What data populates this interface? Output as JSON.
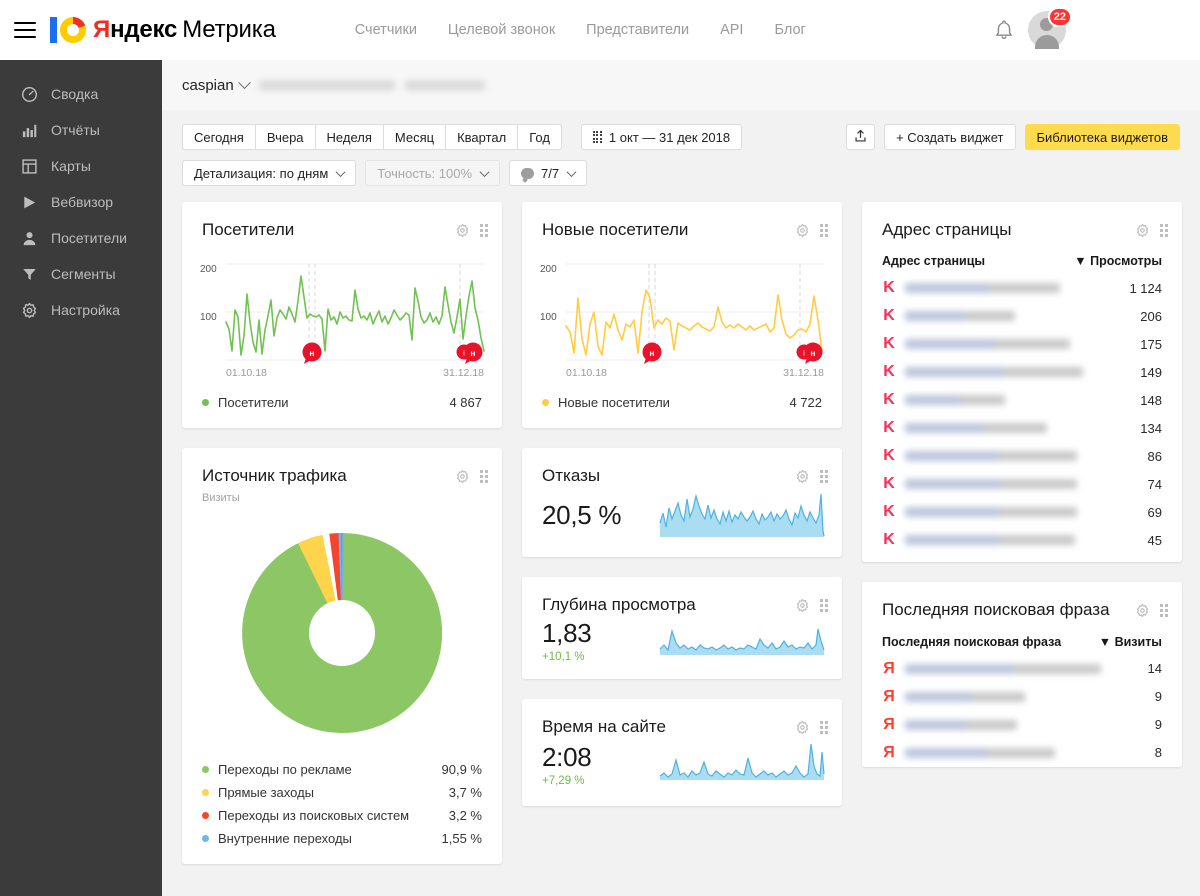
{
  "header": {
    "menu_icon": "hamburger-icon",
    "logo": {
      "ya": "Я",
      "ndeks": "ндекс",
      "product": "Метрика"
    },
    "nav": [
      {
        "label": "Счетчики"
      },
      {
        "label": "Целевой звонок"
      },
      {
        "label": "Представители"
      },
      {
        "label": "API"
      },
      {
        "label": "Блог"
      }
    ],
    "bell_icon": "bell-icon",
    "notification_count": "22",
    "avatar_icon": "user-avatar-icon",
    "user_name": ""
  },
  "sidebar": {
    "items": [
      {
        "label": "Сводка",
        "icon": "gauge-icon"
      },
      {
        "label": "Отчёты",
        "icon": "bar-chart-icon"
      },
      {
        "label": "Карты",
        "icon": "map-grid-icon"
      },
      {
        "label": "Вебвизор",
        "icon": "play-icon"
      },
      {
        "label": "Посетители",
        "icon": "person-icon"
      },
      {
        "label": "Сегменты",
        "icon": "funnel-icon"
      },
      {
        "label": "Настройка",
        "icon": "gear-icon"
      }
    ]
  },
  "breadcrumb": {
    "counter_name": "caspian",
    "chevron_icon": "chevron-down-icon",
    "site_redacted": "",
    "counter_id_redacted": ""
  },
  "toolbar": {
    "periods": [
      "Сегодня",
      "Вчера",
      "Неделя",
      "Месяц",
      "Квартал",
      "Год"
    ],
    "date_range": "1 окт — 31 дек 2018",
    "calendar_icon": "calendar-icon",
    "detail": "Детализация: по дням",
    "accuracy": "Точность: 100%",
    "comments": "7/7",
    "comment_icon": "speech-bubble-icon",
    "export_icon": "export-icon",
    "create_widget": "+ Создать виджет",
    "widget_library": "Библиотека виджетов",
    "accent_yellow": "#ffdb4d"
  },
  "widgets": {
    "visitors": {
      "title": "Посетители",
      "legend_label": "Посетители",
      "total": "4 867",
      "color": "#71c153",
      "x_start": "01.10.18",
      "x_end": "31.12.18",
      "y_ticks": [
        "200",
        "100"
      ],
      "marker_label": "н"
    },
    "new_visitors": {
      "title": "Новые посетители",
      "legend_label": "Новые посетители",
      "total": "4 722",
      "color": "#ffcc42",
      "x_start": "01.10.18",
      "x_end": "31.12.18",
      "y_ticks": [
        "200",
        "100"
      ],
      "marker_label": "н"
    },
    "traffic_source": {
      "title": "Источник трафика",
      "subtitle": "Визиты"
    },
    "bounce": {
      "title": "Отказы",
      "value": "20,5 %",
      "color": "#7ec8e8"
    },
    "depth": {
      "title": "Глубина просмотра",
      "value": "1,83",
      "delta": "+10,1 %",
      "color": "#7ec8e8"
    },
    "time_on_site": {
      "title": "Время на сайте",
      "value": "2:08",
      "delta": "+7,29 %",
      "color": "#7ec8e8"
    },
    "page_address": {
      "title": "Адрес страницы",
      "col_label": "Адрес страницы",
      "col_metric": "▼ Просмотры",
      "favicon": "K",
      "rows": [
        {
          "url": "",
          "views": "1 124"
        },
        {
          "url": "",
          "views": "206"
        },
        {
          "url": "",
          "views": "175"
        },
        {
          "url": "",
          "views": "149"
        },
        {
          "url": "",
          "views": "148"
        },
        {
          "url": "",
          "views": "134"
        },
        {
          "url": "",
          "views": "86"
        },
        {
          "url": "",
          "views": "74"
        },
        {
          "url": "",
          "views": "69"
        },
        {
          "url": "",
          "views": "45"
        }
      ]
    },
    "last_search_phrase": {
      "title": "Последняя поисковая фраза",
      "col_label": "Последняя поисковая фраза",
      "col_metric": "▼ Визиты",
      "favicon": "Я",
      "rows": [
        {
          "phrase": "",
          "visits": "14"
        },
        {
          "phrase": "",
          "visits": "9"
        },
        {
          "phrase": "",
          "visits": "9"
        },
        {
          "phrase": "",
          "visits": "8"
        }
      ]
    }
  },
  "chart_data": [
    {
      "type": "line",
      "title": "Посетители",
      "xlabel": "",
      "ylabel": "",
      "x": [
        "01.10.18",
        "31.12.18"
      ],
      "ylim": [
        0,
        230
      ],
      "yticks": [
        100,
        200
      ],
      "grid": true,
      "legend": [
        {
          "name": "Посетители",
          "total": 4867,
          "color": "#71c153"
        }
      ],
      "series": [
        {
          "name": "Посетители",
          "color": "#71c153",
          "values": [
            88,
            72,
            40,
            110,
            95,
            30,
            62,
            140,
            88,
            52,
            38,
            92,
            34,
            80,
            100,
            128,
            72,
            96,
            110,
            104,
            98,
            118,
            104,
            92,
            124,
            174,
            130,
            96,
            104,
            100,
            98,
            102,
            96,
            40,
            112,
            92,
            98,
            84,
            106,
            96,
            100,
            92,
            90,
            148,
            112,
            94,
            98,
            92,
            104,
            86,
            96,
            108,
            90,
            98,
            84,
            94,
            110,
            100,
            92,
            96,
            104,
            100,
            56,
            150,
            124,
            96,
            86,
            92,
            104,
            88,
            96,
            84,
            100,
            152,
            116,
            88,
            68,
            96,
            122,
            62,
            104,
            96,
            132,
            160,
            108,
            92,
            60,
            98,
            40
          ]
        }
      ]
    },
    {
      "type": "line",
      "title": "Новые посетители",
      "xlabel": "",
      "ylabel": "",
      "x": [
        "01.10.18",
        "31.12.18"
      ],
      "ylim": [
        0,
        230
      ],
      "yticks": [
        100,
        200
      ],
      "grid": true,
      "legend": [
        {
          "name": "Новые посетители",
          "total": 4722,
          "color": "#ffcc42"
        }
      ],
      "series": [
        {
          "name": "Новые посетители",
          "color": "#ffcc42",
          "values": [
            84,
            70,
            36,
            126,
            62,
            30,
            76,
            96,
            42,
            30,
            88,
            78,
            100,
            72,
            56,
            88,
            84,
            96,
            30,
            100,
            148,
            128,
            76,
            92,
            88,
            104,
            96,
            36,
            92,
            86,
            82,
            78,
            88,
            94,
            86,
            80,
            76,
            84,
            118,
            92,
            80,
            86,
            80,
            90,
            84,
            78,
            86,
            76,
            82,
            84,
            88,
            74,
            80,
            130,
            96,
            72,
            66,
            70,
            78,
            80,
            76,
            88,
            130,
            96,
            80,
            70,
            64,
            84,
            36,
            76,
            92,
            132,
            118,
            84,
            62,
            86,
            98,
            40
          ]
        }
      ]
    },
    {
      "type": "pie",
      "title": "Источник трафика",
      "subtitle": "Визиты",
      "labels": [
        "Переходы по рекламе",
        "Прямые заходы",
        "Переходы из поисковых систем",
        "Внутренние переходы"
      ],
      "values": [
        90.9,
        3.7,
        3.2,
        1.55
      ],
      "value_labels": [
        "90,9 %",
        "3,7 %",
        "3,2 %",
        "1,55 %"
      ],
      "colors": [
        "#8cc665",
        "#ffd44d",
        "#f4452e",
        "#6fb7e8"
      ],
      "legend": "bottom",
      "donut": true
    },
    {
      "type": "area",
      "title": "Отказы",
      "value": "20,5 %",
      "color": "#7ec8e8",
      "values": [
        40,
        56,
        30,
        62,
        44,
        58,
        70,
        52,
        44,
        78,
        48,
        60,
        82,
        66,
        54,
        46,
        70,
        50,
        64,
        46,
        38,
        58,
        44,
        60,
        40,
        54,
        46,
        58,
        50,
        44,
        52,
        62,
        48,
        40,
        56,
        46,
        52,
        60,
        44,
        56,
        48,
        54,
        62,
        46,
        38,
        58,
        50,
        66,
        54,
        44,
        60,
        50,
        42,
        56,
        48,
        62,
        40,
        54,
        46,
        58,
        88,
        60,
        12
      ]
    },
    {
      "type": "area",
      "title": "Глубина просмотра",
      "value": "1,83",
      "delta": "+10,1 %",
      "color": "#7ec8e8",
      "values": [
        24,
        30,
        22,
        64,
        34,
        26,
        30,
        24,
        28,
        22,
        30,
        26,
        24,
        28,
        22,
        26,
        30,
        24,
        28,
        22,
        26,
        24,
        30,
        28,
        24,
        38,
        30,
        26,
        32,
        24,
        28,
        34,
        26,
        30,
        24,
        28,
        26,
        32,
        24,
        30,
        26,
        28,
        24,
        30,
        40,
        34,
        28,
        62,
        78,
        46,
        34,
        28,
        24,
        30,
        26,
        22
      ]
    },
    {
      "type": "area",
      "title": "Время на сайте",
      "value": "2:08",
      "delta": "+7,29 %",
      "color": "#7ec8e8",
      "values": [
        18,
        22,
        16,
        20,
        46,
        18,
        22,
        16,
        24,
        18,
        20,
        36,
        22,
        18,
        24,
        20,
        16,
        22,
        18,
        24,
        20,
        18,
        42,
        22,
        16,
        20,
        24,
        18,
        22,
        16,
        20,
        24,
        18,
        22,
        30,
        20,
        16,
        22,
        18,
        26,
        20,
        18,
        22,
        16,
        34,
        24,
        18,
        20,
        96,
        40,
        22,
        18,
        24,
        20,
        16,
        62,
        26,
        14
      ]
    },
    {
      "type": "table",
      "title": "Адрес страницы",
      "columns": [
        "Адрес страницы",
        "Просмотры"
      ],
      "sort": "Просмотры desc",
      "values": [
        1124,
        206,
        175,
        149,
        148,
        134,
        86,
        74,
        69,
        45
      ]
    },
    {
      "type": "table",
      "title": "Последняя поисковая фраза",
      "columns": [
        "Последняя поисковая фраза",
        "Визиты"
      ],
      "sort": "Визиты desc",
      "values": [
        14,
        9,
        9,
        8
      ]
    }
  ]
}
